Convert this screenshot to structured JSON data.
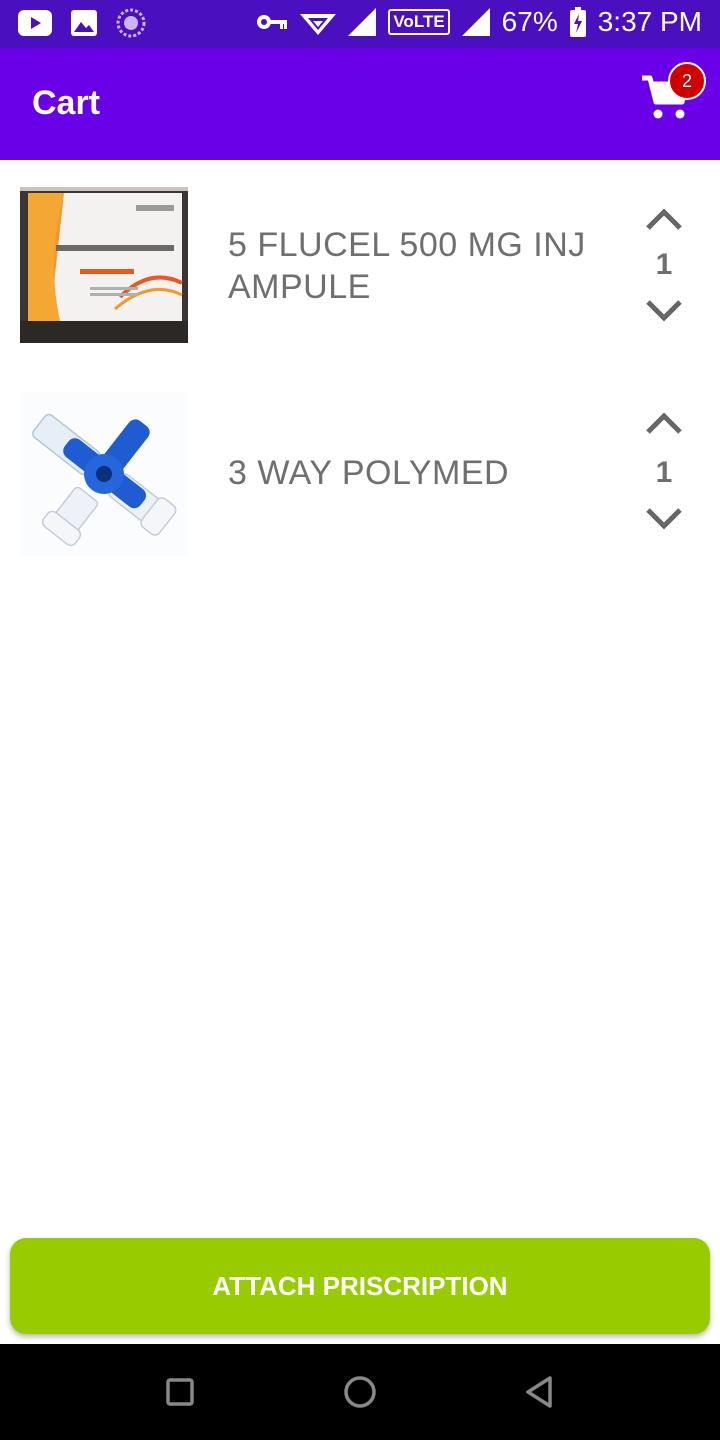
{
  "status_bar": {
    "icons": [
      "youtube-icon",
      "gallery-icon",
      "sync-icon",
      "vpn-key-icon",
      "wifi-icon",
      "signal-icon",
      "volte-icon",
      "signal-icon",
      "battery-icon"
    ],
    "volte": "VoLTE",
    "battery": "67%",
    "time": "3:37 PM"
  },
  "app_bar": {
    "title": "Cart",
    "cart_icon": "shopping-cart-icon",
    "cart_count": "2"
  },
  "items": [
    {
      "name": "5 FLUCEL 500 MG INJ AMPULE",
      "quantity": "1",
      "image_icon": "medicine-box-image"
    },
    {
      "name": "3 WAY POLYMED",
      "quantity": "1",
      "image_icon": "three-way-stopcock-image"
    }
  ],
  "colors": {
    "status_bar": "#4a0fbf",
    "app_bar": "#6a00e8",
    "badge": "#d10000",
    "button": "#99cc00",
    "item_text": "#6f6f6f"
  },
  "attach_button": {
    "label": "ATTACH PRISCRIPTION"
  },
  "nav_bar": {
    "icons": [
      "recent-apps-icon",
      "home-icon",
      "back-icon"
    ]
  }
}
